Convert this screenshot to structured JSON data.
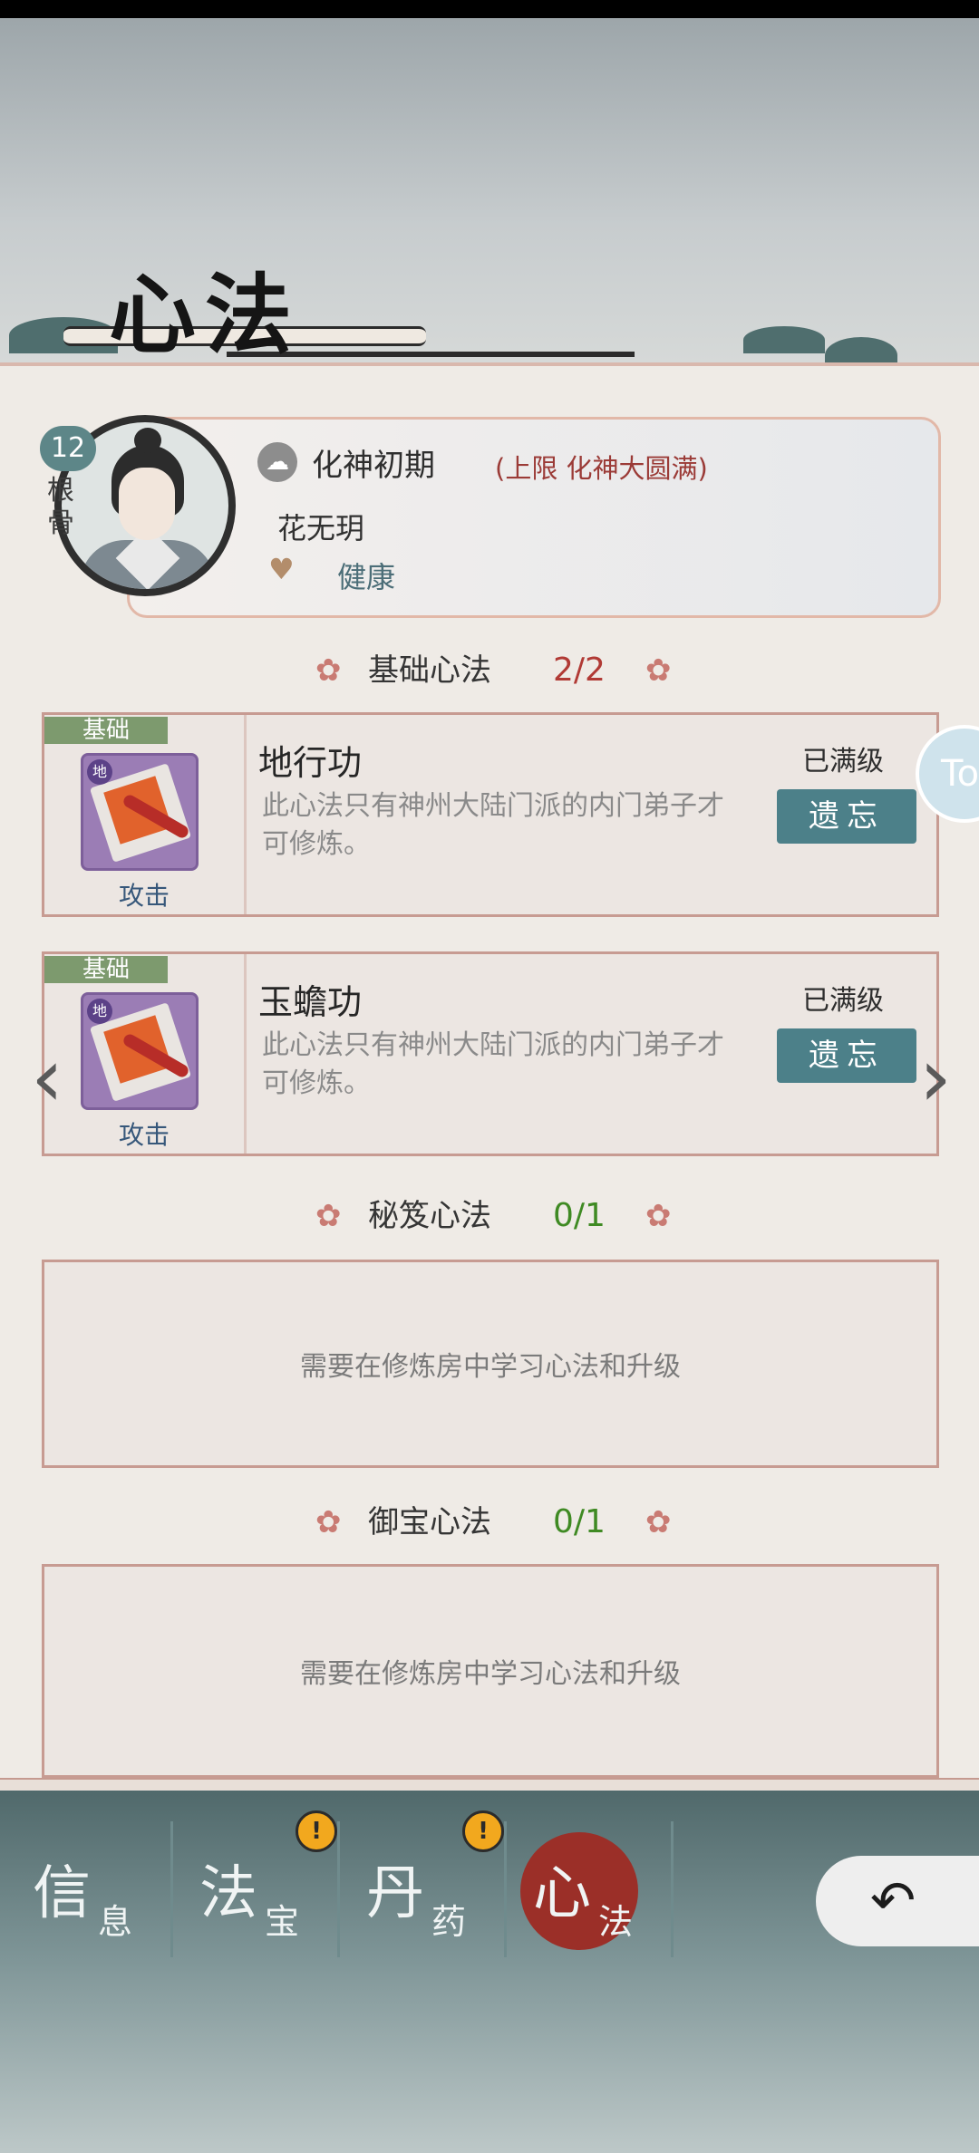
{
  "page_title": "心法",
  "character": {
    "level": "12",
    "root_label": "根骨",
    "realm": "化神初期",
    "realm_limit": "(上限 化神大圆满)",
    "name": "花无玥",
    "health": "健康"
  },
  "sections": {
    "basic": {
      "title": "基础心法",
      "count": "2/2"
    },
    "secret": {
      "title": "秘笈心法",
      "count": "0/1"
    },
    "treasure": {
      "title": "御宝心法",
      "count": "0/1"
    }
  },
  "skills": [
    {
      "tag": "基础",
      "type": "攻击",
      "name": "地行功",
      "desc": "此心法只有神州大陆门派的内门弟子才可修炼。",
      "status": "已满级",
      "action": "遗忘"
    },
    {
      "tag": "基础",
      "type": "攻击",
      "name": "玉蟾功",
      "desc": "此心法只有神州大陆门派的内门弟子才可修炼。",
      "status": "已满级",
      "action": "遗忘"
    }
  ],
  "empty_slot_text": "需要在修炼房中学习心法和升级",
  "tabs": [
    {
      "main": "信",
      "sub": "息"
    },
    {
      "main": "法",
      "sub": "宝"
    },
    {
      "main": "丹",
      "sub": "药"
    },
    {
      "main": "心",
      "sub": "法"
    }
  ],
  "side_bubble_text": "To",
  "alert_symbol": "!",
  "colors": {
    "accent_red": "#9b2f28",
    "button_teal": "#4c8089",
    "count_red": "#b13a35",
    "count_green": "#3f8a23"
  }
}
